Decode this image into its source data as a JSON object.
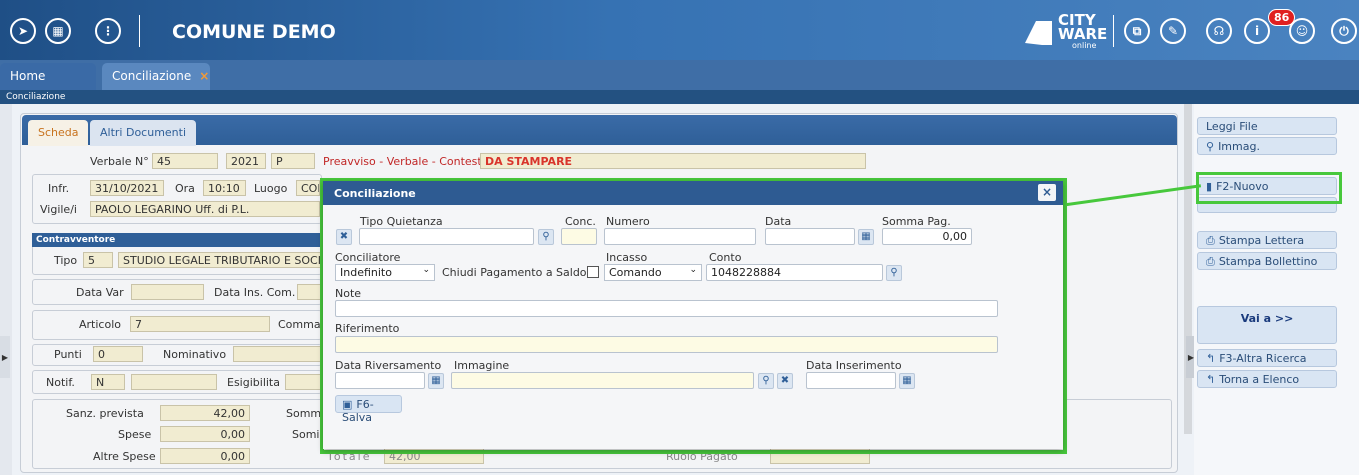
{
  "app": {
    "title": "COMUNE DEMO",
    "badge": "86",
    "logo_city": "CITY",
    "logo_ware": "WARE",
    "logo_online": "online"
  },
  "tabs": [
    {
      "label": "Home"
    },
    {
      "label": "Conciliazione",
      "close": "×"
    }
  ],
  "breadcrumb": "Conciliazione",
  "panel_tabs": [
    "Scheda",
    "Altri Documenti"
  ],
  "form": {
    "verbale_label": "Verbale N°",
    "verbale_num": "45",
    "verbale_anno": "2021",
    "verbale_tipo": "P",
    "preavviso": "Preavviso",
    "verbale": "Verbale",
    "contestazione": "Contestazione",
    "dash": " - ",
    "stato": "DA STAMPARE",
    "infr_label": "Infr.",
    "infr_date": "31/10/2021",
    "ora_label": "Ora",
    "ora": "10:10",
    "luogo_label": "Luogo",
    "luogo": "COR",
    "vigile_label": "Vigile/i",
    "vigile": "PAOLO  LEGARINO Uff. di P.L.",
    "contravventore": "Contravventore",
    "tipo_label": "Tipo",
    "tipo": "5",
    "tipo_desc": "STUDIO LEGALE TRIBUTARIO E SOCIET",
    "data_var": "Data Var",
    "data_ins_com": "Data Ins. Com.",
    "articolo_label": "Articolo",
    "articolo": "7",
    "comma": "Comma",
    "punti_label": "Punti",
    "punti": "0",
    "nominativo": "Nominativo",
    "notif_label": "Notif.",
    "notif": "N",
    "esigibilita": "Esigibilita",
    "sanz_label": "Sanz. prevista",
    "sanz": "42,00",
    "somm1": "Somm",
    "spese_label": "Spese",
    "spese": "0,00",
    "somm2": "Somi",
    "altre_label": "Altre Spese",
    "altre": "0,00",
    "totale_label": "Totale",
    "totale": "42,00",
    "ruolo_label": "Ruolo Pagato"
  },
  "sidebar": {
    "leggi_file": "Leggi File",
    "immag": "Immag.",
    "nuovo": "F2-Nuovo",
    "stampa_lettera": "Stampa Lettera",
    "stampa_bollettino": "Stampa Bollettino",
    "vai_a": "Vai a >>",
    "altra_ricerca": "F3-Altra Ricerca",
    "torna_elenco": "Torna a Elenco"
  },
  "dialog": {
    "title": "Conciliazione",
    "close": "×",
    "tipo_quietanza": "Tipo Quietanza",
    "conc": "Conc.",
    "numero": "Numero",
    "data": "Data",
    "somma_pag": "Somma Pag.",
    "somma_pag_value": "0,00",
    "conciliatore": "Conciliatore",
    "conciliatore_value": "Indefinito",
    "chiudi_pagamento": "Chiudi Pagamento a Saldo",
    "incasso": "Incasso",
    "incasso_value": "Comando",
    "conto": "Conto",
    "conto_value": "1048228884",
    "note": "Note",
    "riferimento": "Riferimento",
    "data_riversamento": "Data Riversamento",
    "immagine": "Immagine",
    "data_inserimento": "Data Inserimento",
    "salva": "F6-Salva"
  },
  "colors": {
    "accent": "#2f5f98",
    "highlight": "#47c83c",
    "status": "#d9342b"
  }
}
